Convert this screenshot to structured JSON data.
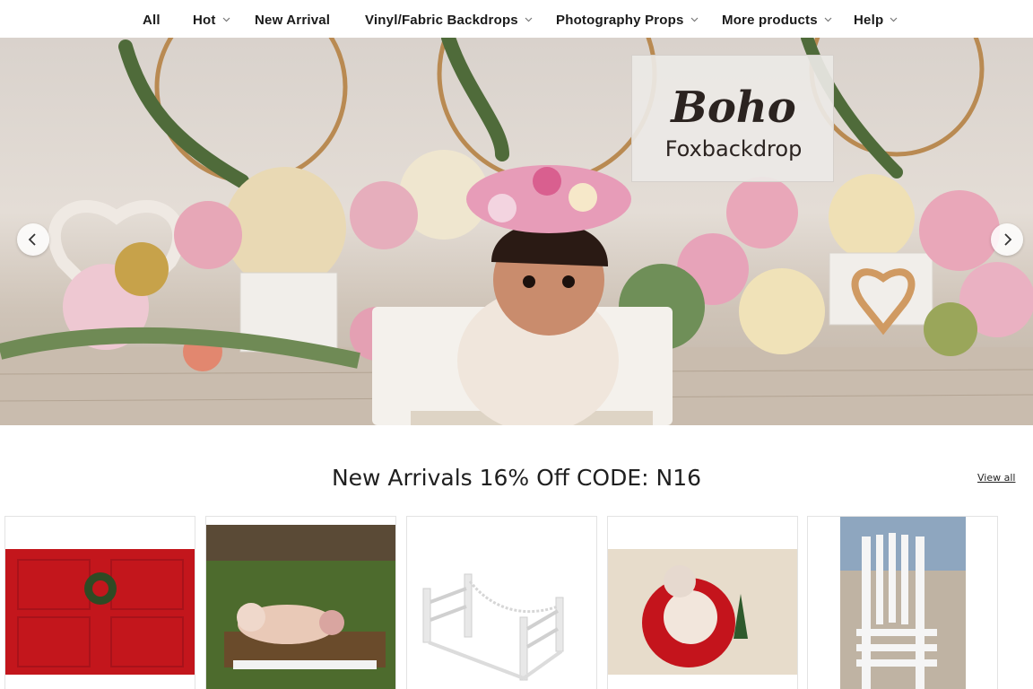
{
  "nav": {
    "items": [
      {
        "label": "All",
        "has_dropdown": false
      },
      {
        "label": "Hot",
        "has_dropdown": true
      },
      {
        "label": "New Arrival",
        "has_dropdown": false
      },
      {
        "label": "Vinyl/Fabric Backdrops",
        "has_dropdown": true
      },
      {
        "label": "Photography Props",
        "has_dropdown": true
      },
      {
        "label": "More products",
        "has_dropdown": true
      },
      {
        "label": "Help",
        "has_dropdown": true
      }
    ]
  },
  "hero": {
    "title": "Boho",
    "subtitle": "Foxbackdrop",
    "prev_icon": "chevron-left-icon",
    "next_icon": "chevron-right-icon"
  },
  "section": {
    "title": "New Arrivals 16% Off CODE: N16",
    "view_all": "View all"
  },
  "products": [
    {
      "image": "red-christmas-wreath-backdrop"
    },
    {
      "image": "newborn-in-log-bed-prop"
    },
    {
      "image": "white-wooden-bed-prop"
    },
    {
      "image": "newborn-in-red-armchair"
    },
    {
      "image": "white-wooden-chair-prop"
    }
  ],
  "colors": {
    "accent_red": "#c3161c",
    "text_dark": "#1a1a1a"
  }
}
